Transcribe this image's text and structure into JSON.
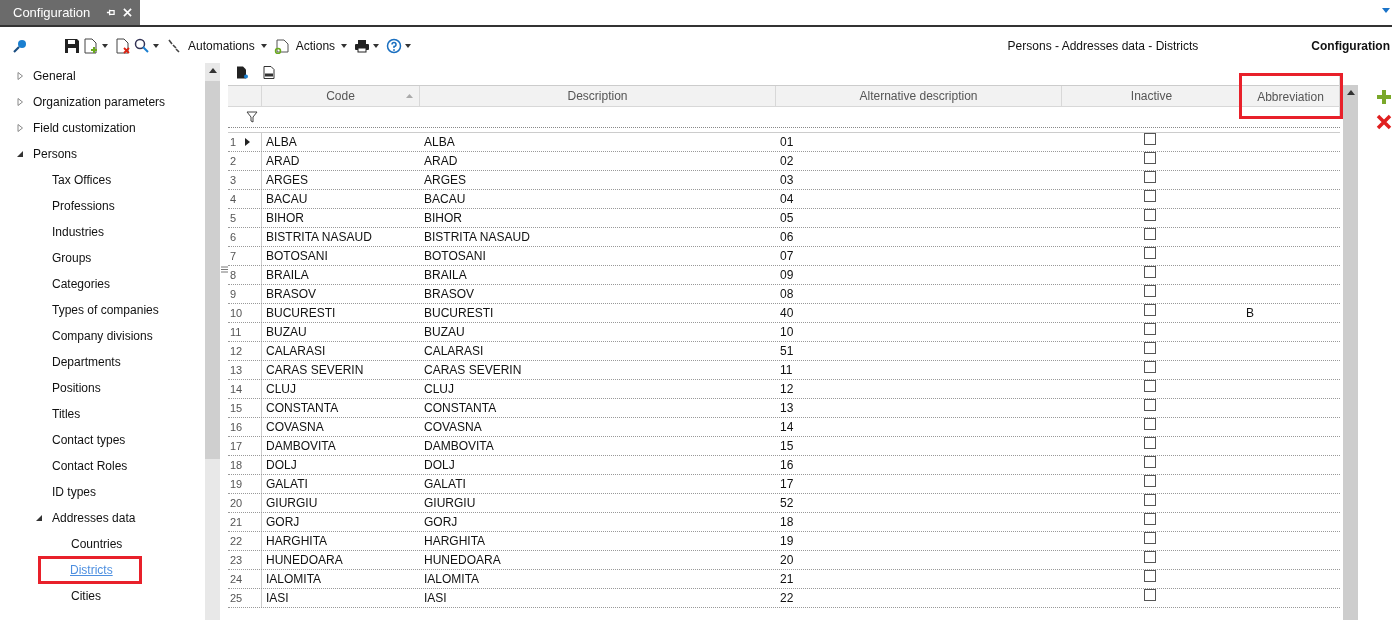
{
  "tab": {
    "title": "Configuration"
  },
  "toolbar": {
    "automations": "Automations",
    "actions": "Actions",
    "breadcrumb": "Persons - Addresses data - Districts",
    "module": "Configuration"
  },
  "tree": [
    {
      "label": "General",
      "expanded": false,
      "selected": false,
      "highlighted": false
    },
    {
      "label": "Organization parameters",
      "expanded": false,
      "selected": false,
      "highlighted": false
    },
    {
      "label": "Field customization",
      "expanded": false,
      "selected": false,
      "highlighted": false
    },
    {
      "label": "Persons",
      "expanded": true,
      "selected": false,
      "highlighted": false,
      "children": [
        {
          "label": "Tax Offices",
          "selected": false,
          "highlighted": false
        },
        {
          "label": "Professions",
          "selected": false,
          "highlighted": false
        },
        {
          "label": "Industries",
          "selected": false,
          "highlighted": false
        },
        {
          "label": "Groups",
          "selected": false,
          "highlighted": false
        },
        {
          "label": "Categories",
          "selected": false,
          "highlighted": false
        },
        {
          "label": "Types of companies",
          "selected": false,
          "highlighted": false
        },
        {
          "label": "Company divisions",
          "selected": false,
          "highlighted": false
        },
        {
          "label": "Departments",
          "selected": false,
          "highlighted": false
        },
        {
          "label": "Positions",
          "selected": false,
          "highlighted": false
        },
        {
          "label": "Titles",
          "selected": false,
          "highlighted": false
        },
        {
          "label": "Contact types",
          "selected": false,
          "highlighted": false
        },
        {
          "label": "Contact Roles",
          "selected": false,
          "highlighted": false
        },
        {
          "label": "ID types",
          "selected": false,
          "highlighted": false
        },
        {
          "label": "Addresses data",
          "expanded": true,
          "selected": false,
          "highlighted": false,
          "children": [
            {
              "label": "Countries",
              "selected": false,
              "highlighted": false
            },
            {
              "label": "Districts",
              "selected": true,
              "highlighted": true
            },
            {
              "label": "Cities",
              "selected": false,
              "highlighted": false
            }
          ]
        }
      ]
    }
  ],
  "table": {
    "columns": [
      {
        "label": "Code",
        "sorted": true,
        "highlighted": false
      },
      {
        "label": "Description",
        "sorted": false,
        "highlighted": false
      },
      {
        "label": "Alternative description",
        "sorted": false,
        "highlighted": false
      },
      {
        "label": "Inactive",
        "sorted": false,
        "highlighted": false
      },
      {
        "label": "Abbreviation",
        "sorted": false,
        "highlighted": true
      }
    ],
    "rows": [
      {
        "num": "1",
        "code": "ALBA",
        "description": "ALBA",
        "alt": "01",
        "inactive": false,
        "current": true
      },
      {
        "num": "2",
        "code": "ARAD",
        "description": "ARAD",
        "alt": "02",
        "inactive": false,
        "current": false
      },
      {
        "num": "3",
        "code": "ARGES",
        "description": "ARGES",
        "alt": "03",
        "inactive": false,
        "current": false
      },
      {
        "num": "4",
        "code": "BACAU",
        "description": "BACAU",
        "alt": "04",
        "inactive": false,
        "current": false
      },
      {
        "num": "5",
        "code": "BIHOR",
        "description": "BIHOR",
        "alt": "05",
        "inactive": false,
        "current": false
      },
      {
        "num": "6",
        "code": "BISTRITA NASAUD",
        "description": "BISTRITA NASAUD",
        "alt": "06",
        "inactive": false,
        "current": false
      },
      {
        "num": "7",
        "code": "BOTOSANI",
        "description": "BOTOSANI",
        "alt": "07",
        "inactive": false,
        "current": false
      },
      {
        "num": "8",
        "code": "BRAILA",
        "description": "BRAILA",
        "alt": "09",
        "inactive": false,
        "current": false
      },
      {
        "num": "9",
        "code": "BRASOV",
        "description": "BRASOV",
        "alt": "08",
        "inactive": false,
        "current": false
      },
      {
        "num": "10",
        "code": "BUCURESTI",
        "description": "BUCURESTI",
        "alt": "40",
        "inactive": false,
        "abbreviation": "B",
        "current": false
      },
      {
        "num": "11",
        "code": "BUZAU",
        "description": "BUZAU",
        "alt": "10",
        "inactive": false,
        "current": false
      },
      {
        "num": "12",
        "code": "CALARASI",
        "description": "CALARASI",
        "alt": "51",
        "inactive": false,
        "current": false
      },
      {
        "num": "13",
        "code": "CARAS SEVERIN",
        "description": "CARAS SEVERIN",
        "alt": "11",
        "inactive": false,
        "current": false
      },
      {
        "num": "14",
        "code": "CLUJ",
        "description": "CLUJ",
        "alt": "12",
        "inactive": false,
        "current": false
      },
      {
        "num": "15",
        "code": "CONSTANTA",
        "description": "CONSTANTA",
        "alt": "13",
        "inactive": false,
        "current": false
      },
      {
        "num": "16",
        "code": "COVASNA",
        "description": "COVASNA",
        "alt": "14",
        "inactive": false,
        "current": false
      },
      {
        "num": "17",
        "code": "DAMBOVITA",
        "description": "DAMBOVITA",
        "alt": "15",
        "inactive": false,
        "current": false
      },
      {
        "num": "18",
        "code": "DOLJ",
        "description": "DOLJ",
        "alt": "16",
        "inactive": false,
        "current": false
      },
      {
        "num": "19",
        "code": "GALATI",
        "description": "GALATI",
        "alt": "17",
        "inactive": false,
        "current": false
      },
      {
        "num": "20",
        "code": "GIURGIU",
        "description": "GIURGIU",
        "alt": "52",
        "inactive": false,
        "current": false
      },
      {
        "num": "21",
        "code": "GORJ",
        "description": "GORJ",
        "alt": "18",
        "inactive": false,
        "current": false
      },
      {
        "num": "22",
        "code": "HARGHITA",
        "description": "HARGHITA",
        "alt": "19",
        "inactive": false,
        "current": false
      },
      {
        "num": "23",
        "code": "HUNEDOARA",
        "description": "HUNEDOARA",
        "alt": "20",
        "inactive": false,
        "current": false
      },
      {
        "num": "24",
        "code": "IALOMITA",
        "description": "IALOMITA",
        "alt": "21",
        "inactive": false,
        "current": false
      },
      {
        "num": "25",
        "code": "IASI",
        "description": "IASI",
        "alt": "22",
        "inactive": false,
        "current": false
      }
    ]
  }
}
